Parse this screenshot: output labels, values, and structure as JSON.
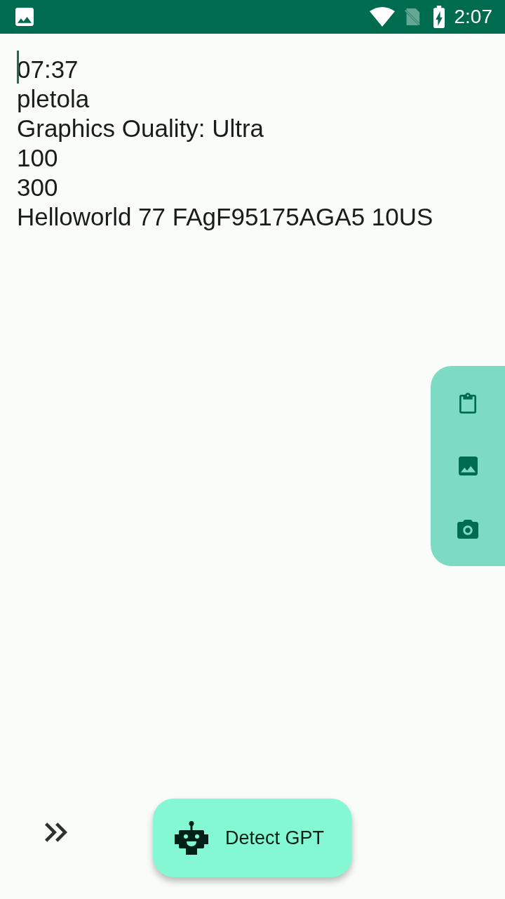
{
  "status_bar": {
    "time": "2:07"
  },
  "editor": {
    "focused": true,
    "lines": [
      "07:37",
      "pletola",
      "Graphics Ouality: Ultra",
      "100",
      "300",
      "Helloworld 77 FAgF95175AGA5 10US"
    ]
  },
  "side_panel": {
    "actions": [
      {
        "kind": "clipboard"
      },
      {
        "kind": "image"
      },
      {
        "kind": "camera"
      }
    ]
  },
  "detect_button": {
    "label": "Detect GPT"
  }
}
